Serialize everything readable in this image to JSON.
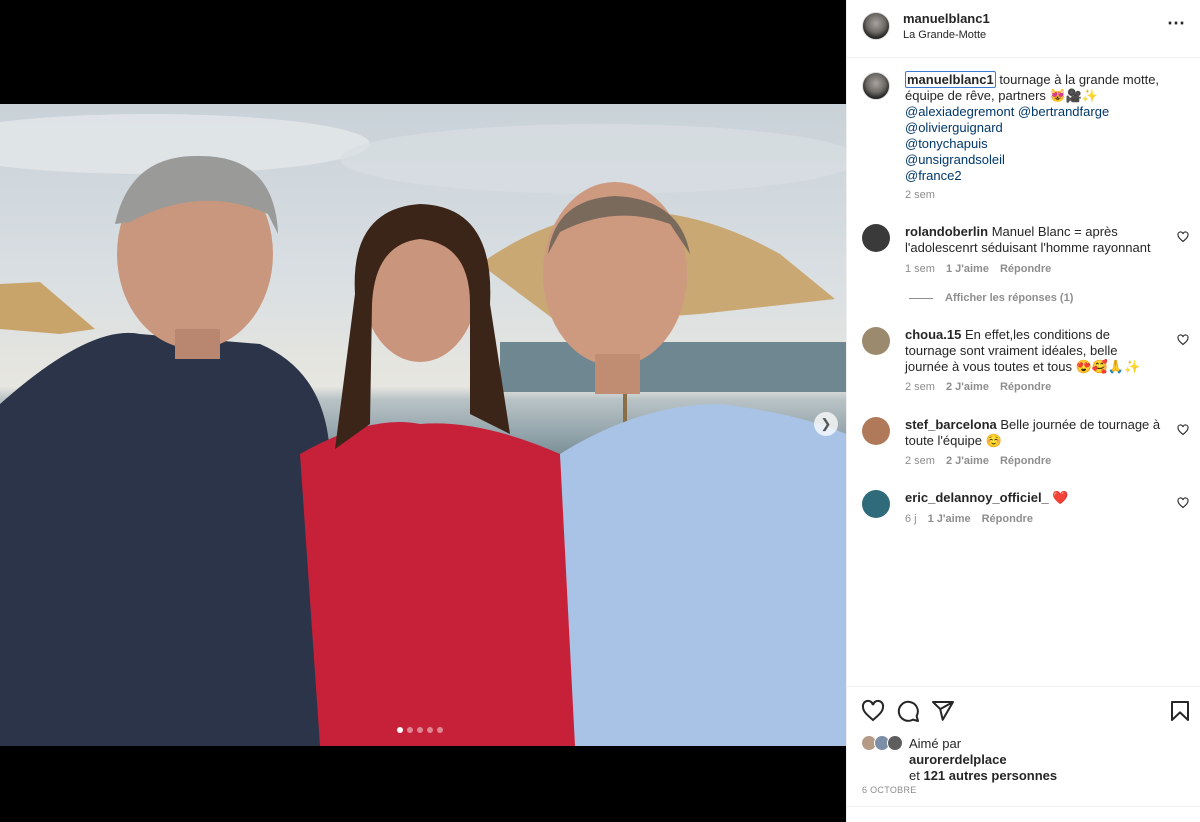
{
  "header": {
    "username": "manuelblanc1",
    "location": "La Grande-Motte",
    "more_icon": "more-horizontal-icon"
  },
  "media": {
    "carousel_dots": 5,
    "active_dot": 1,
    "next_icon": "chevron-right-icon"
  },
  "caption": {
    "username": "manuelblanc1",
    "text": " tournage à la grande motte, équipe de rêve, partners 😻🎥✨",
    "mentions": [
      "@alexiadegremont @bertrandfarge",
      "@olivierguignard",
      "@tonychapuis",
      "@unsigrandsoleil",
      "@france2"
    ],
    "time": "2 sem"
  },
  "comments": [
    {
      "username": "rolandoberlin",
      "text": "Manuel Blanc = après l'adolescenrt séduisant l'homme rayonnant",
      "time": "1 sem",
      "likes": "1 J'aime",
      "reply": "Répondre",
      "view_replies": "Afficher les réponses (1)",
      "avatar_color": "#3a3a3a"
    },
    {
      "username": "choua.15",
      "text": "En effet,les conditions de tournage sont vraiment idéales, belle journée à vous toutes et tous 😍🥰🙏✨",
      "time": "2 sem",
      "likes": "2 J'aime",
      "reply": "Répondre",
      "avatar_color": "#9c8a6e"
    },
    {
      "username": "stef_barcelona",
      "text": "Belle journée de tournage à toute l'équipe ☺️",
      "time": "2 sem",
      "likes": "2 J'aime",
      "reply": "Répondre",
      "avatar_color": "#b07a5a"
    },
    {
      "username": "eric_delannoy_officiel_",
      "text": "❤️",
      "time": "6 j",
      "likes": "1 J'aime",
      "reply": "Répondre",
      "avatar_color": "#2f6b7a"
    }
  ],
  "actions": {
    "like_icon": "heart-icon",
    "comment_icon": "comment-icon",
    "share_icon": "send-icon",
    "save_icon": "bookmark-icon"
  },
  "likes": {
    "prefix": "Aimé par",
    "user": "aurorerdelplace",
    "rest_prefix": "et",
    "count": "121 autres personnes"
  },
  "date": "6 OCTOBRE"
}
